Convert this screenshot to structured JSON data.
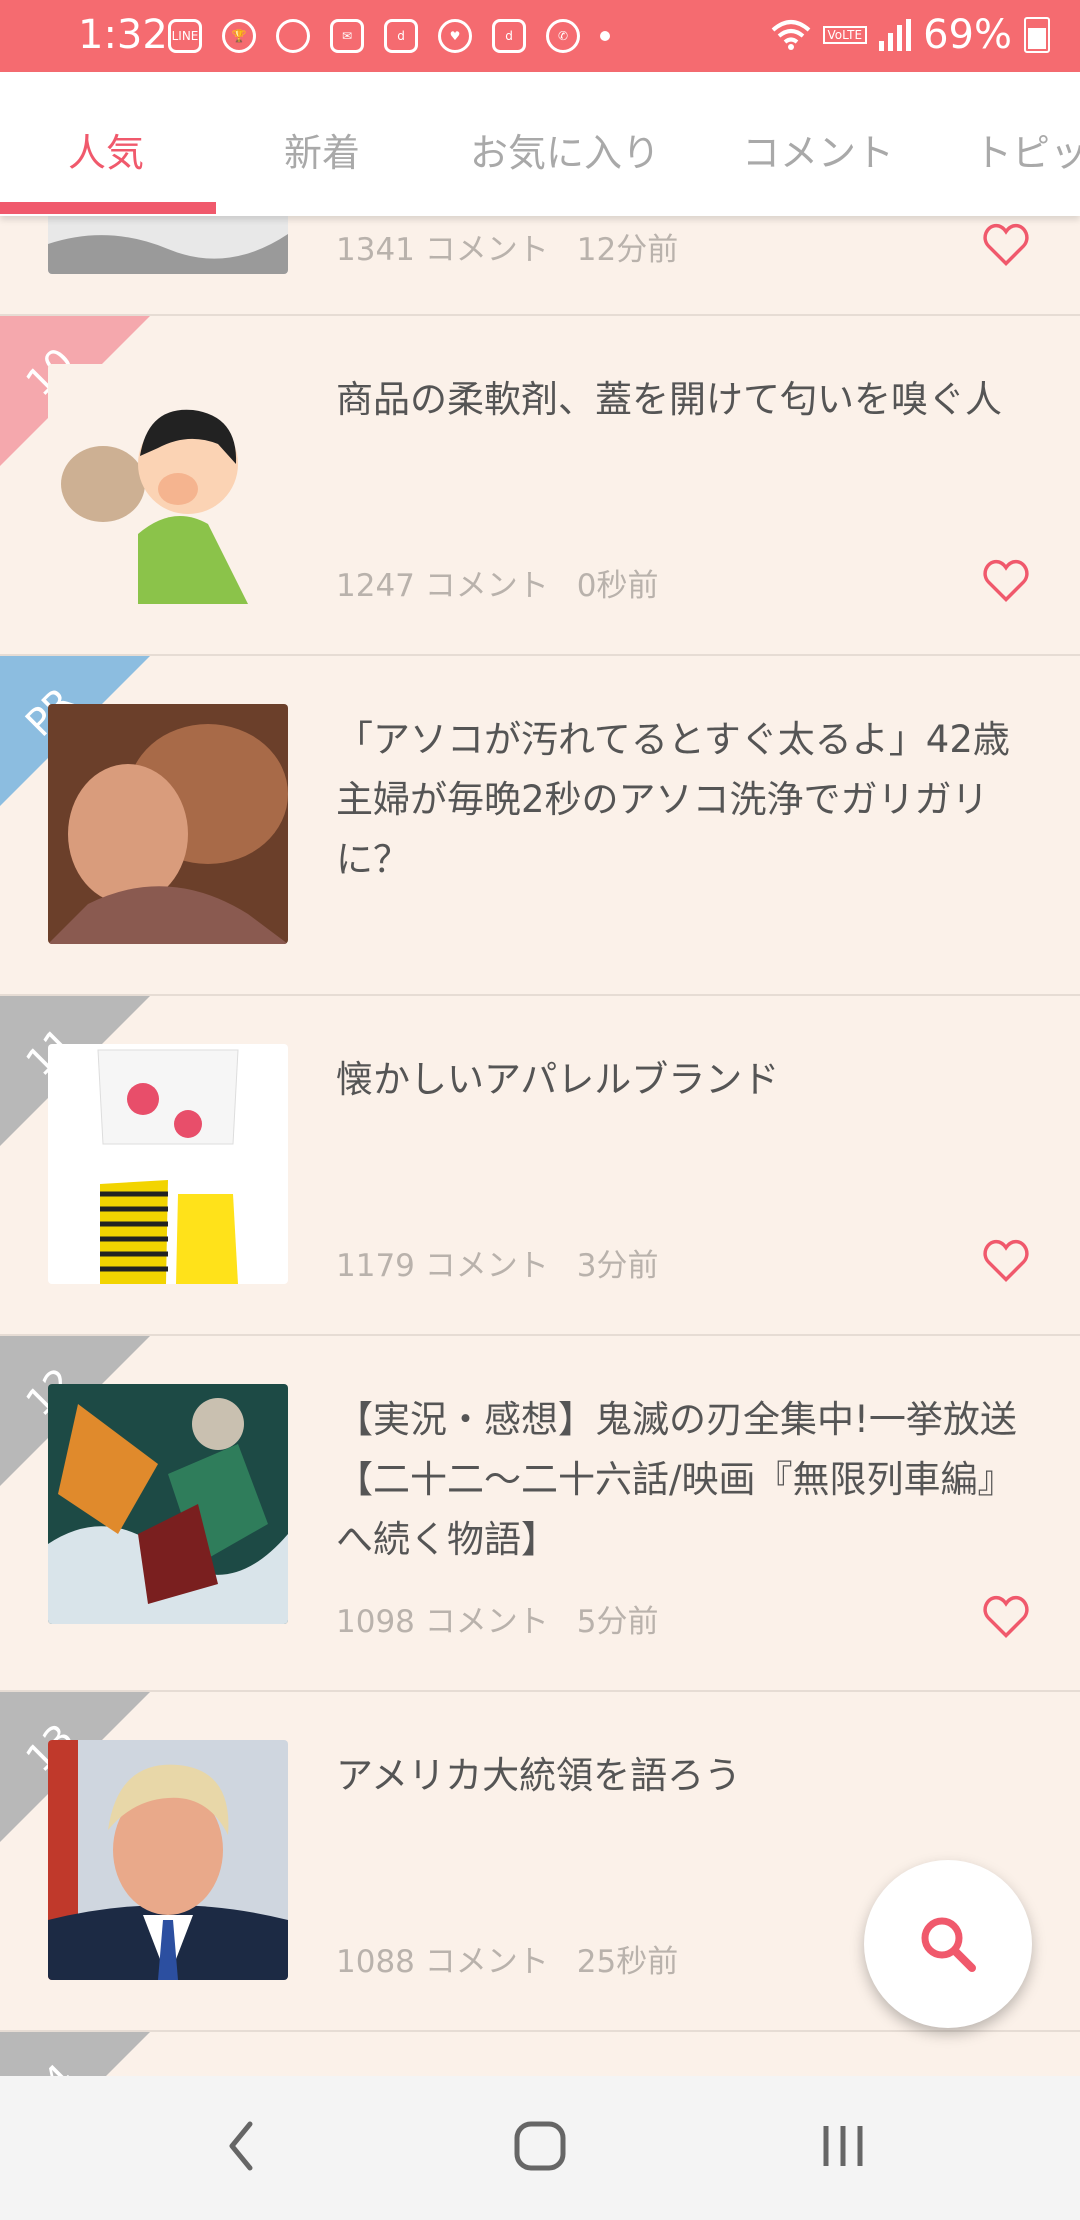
{
  "status_bar": {
    "time": "1:32",
    "battery": "69%",
    "notification_icons": [
      "line-icon",
      "trophy-icon",
      "account-icon",
      "mail-icon",
      "d-app-icon",
      "heart-app-icon",
      "dbook-icon",
      "call-icon"
    ]
  },
  "tabs": [
    {
      "label": "人気",
      "active": true
    },
    {
      "label": "新着"
    },
    {
      "label": "お気に入り"
    },
    {
      "label": "コメント"
    },
    {
      "label": "トピッ"
    }
  ],
  "rows": [
    {
      "rank": "",
      "title": "",
      "comments": "1341 コメント",
      "time": "12分前"
    },
    {
      "rank": "10",
      "title": "商品の柔軟剤、蓋を開けて匂いを嗅ぐ人",
      "comments": "1247 コメント",
      "time": "0秒前"
    },
    {
      "rank": "PR",
      "title": "「アソコが汚れてるとすぐ太るよ」42歳主婦が毎晩2秒のアソコ洗浄でガリガリに？"
    },
    {
      "rank": "11",
      "title": "懐かしいアパレルブランド",
      "comments": "1179 コメント",
      "time": "3分前"
    },
    {
      "rank": "12",
      "title": "【実況・感想】鬼滅の刃全集中!一挙放送【二十二〜二十六話/映画『無限列車編』へ続く物語】",
      "comments": "1098 コメント",
      "time": "5分前"
    },
    {
      "rank": "13",
      "title": "アメリカ大統領を語ろう",
      "comments": "1088 コメント",
      "time": "25秒前"
    },
    {
      "rank": "14"
    }
  ],
  "colors": {
    "accent": "#f0596c",
    "status_bar": "#f56b70",
    "rank_ribbon_pink": "#f5a8ad",
    "rank_ribbon_gray": "#b8b8b8",
    "pr_ribbon": "#8cbde0",
    "background": "#fbf1e9"
  },
  "icons": {
    "favorite": "heart-outline-icon",
    "search": "search-icon",
    "nav_back": "back-icon",
    "nav_home": "home-icon",
    "nav_recents": "recents-icon"
  }
}
